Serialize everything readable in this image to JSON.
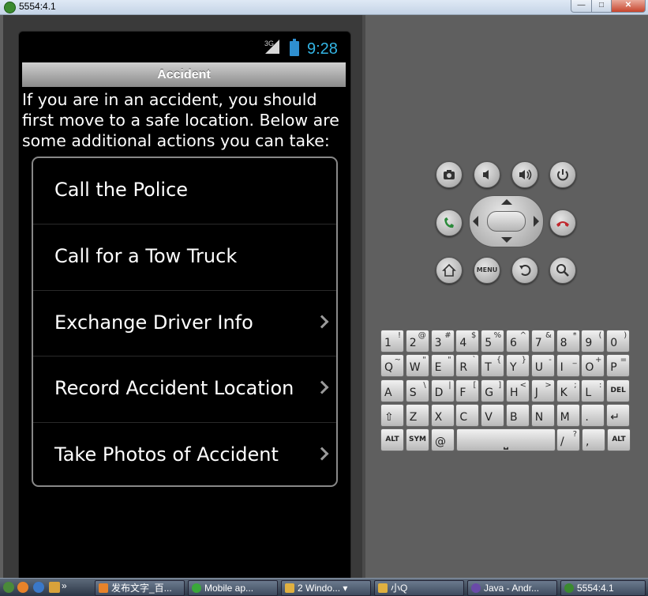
{
  "window": {
    "title": "5554:4.1",
    "min_label": "—",
    "max_label": "□",
    "close_label": "✕"
  },
  "status_bar": {
    "network": "3G",
    "time": "9:28"
  },
  "app": {
    "title": "Accident",
    "intro": "If you are in an accident, you should first move to a safe location. Below are some additional actions you can take:",
    "items": [
      {
        "label": "Call the Police",
        "chevron": false
      },
      {
        "label": "Call for a Tow Truck",
        "chevron": false
      },
      {
        "label": "Exchange Driver Info",
        "chevron": true
      },
      {
        "label": "Record Accident Location",
        "chevron": true
      },
      {
        "label": "Take Photos of Accident",
        "chevron": true
      }
    ]
  },
  "controls": {
    "buttons": [
      "camera-icon",
      "volume-down-icon",
      "volume-up-icon",
      "power-icon",
      "call-icon",
      "end-call-icon",
      "home-icon",
      "menu-icon",
      "back-icon",
      "search-icon"
    ],
    "menu_label": "MENU"
  },
  "keyboard": {
    "rows": [
      [
        [
          "1",
          "!"
        ],
        [
          "2",
          "@"
        ],
        [
          "3",
          "#"
        ],
        [
          "4",
          "$"
        ],
        [
          "5",
          "%"
        ],
        [
          "6",
          "^"
        ],
        [
          "7",
          "&"
        ],
        [
          "8",
          "*"
        ],
        [
          "9",
          "("
        ],
        [
          "0",
          ")"
        ]
      ],
      [
        [
          "Q",
          "~"
        ],
        [
          "W",
          "\""
        ],
        [
          "E",
          "\""
        ],
        [
          "R",
          "`"
        ],
        [
          "T",
          "{"
        ],
        [
          "Y",
          "}"
        ],
        [
          "U",
          "-"
        ],
        [
          "I",
          "_"
        ],
        [
          "O",
          "+"
        ],
        [
          "P",
          "="
        ]
      ],
      [
        [
          "A",
          ""
        ],
        [
          "S",
          "\\"
        ],
        [
          "D",
          "|"
        ],
        [
          "F",
          "["
        ],
        [
          "G",
          "]"
        ],
        [
          "H",
          "<"
        ],
        [
          "J",
          ">"
        ],
        [
          "K",
          ";"
        ],
        [
          "L",
          ":"
        ],
        [
          "DEL",
          ""
        ]
      ],
      [
        [
          "⇧",
          ""
        ],
        [
          "Z",
          ""
        ],
        [
          "X",
          ""
        ],
        [
          "C",
          ""
        ],
        [
          "V",
          ""
        ],
        [
          "B",
          ""
        ],
        [
          "N",
          ""
        ],
        [
          "M",
          ""
        ],
        [
          ".",
          ""
        ],
        [
          "↵",
          ""
        ]
      ],
      [
        [
          "ALT",
          ""
        ],
        [
          "SYM",
          ""
        ],
        [
          "@",
          ""
        ],
        [
          "⎵",
          ""
        ],
        [
          "/",
          "?"
        ],
        [
          ",",
          ""
        ],
        [
          "ALT",
          ""
        ]
      ]
    ]
  },
  "taskbar": {
    "tasks": [
      "发布文字_百...",
      "Mobile ap...",
      "2 Windo...",
      "小Q",
      "Java - Andr...",
      "5554:4.1"
    ],
    "overflow": "»"
  }
}
